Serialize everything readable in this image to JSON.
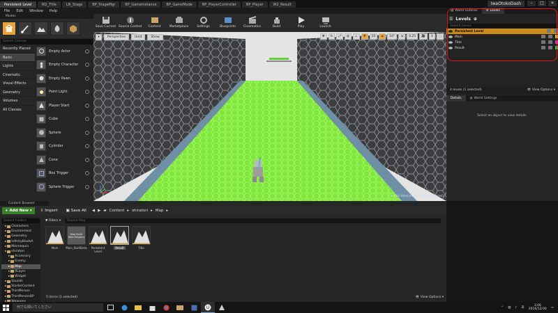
{
  "window": {
    "doc_tabs": [
      "Persistent Level",
      "W2_Title",
      "LN_Stage",
      "BP_StageMgr",
      "BP_GameInstance",
      "BP_GameMode",
      "BP_PlayerController",
      "BP_Player",
      "W2_Result"
    ],
    "project_name": "IwaOtokoDash",
    "win_buttons": [
      "–",
      "□",
      "✕"
    ]
  },
  "menu": [
    "File",
    "Edit",
    "Window",
    "Help"
  ],
  "modes": {
    "tab": "Modes",
    "search_placeholder": "Search Classes",
    "categories": [
      "Recently Placed",
      "Basic",
      "Lights",
      "Cinematic",
      "Visual Effects",
      "Geometry",
      "Volumes",
      "All Classes"
    ],
    "active_category": "Basic",
    "place_items": [
      "Empty Actor",
      "Empty Character",
      "Empty Pawn",
      "Point Light",
      "Player Start",
      "Cube",
      "Sphere",
      "Cylinder",
      "Cone",
      "Box Trigger",
      "Sphere Trigger"
    ]
  },
  "toolbar": {
    "buttons": [
      "Save Current",
      "Source Control",
      "Content",
      "Marketplace",
      "Settings",
      "Blueprints",
      "Cinematics",
      "Build",
      "Play",
      "Launch"
    ]
  },
  "viewport": {
    "perspective": "Perspective",
    "lit": "Unlit",
    "show": "Show",
    "snap_values": [
      "10",
      "10°",
      "0.25",
      "3"
    ],
    "level_label": "Level:  PersistentLevel (Persistent)"
  },
  "right_panel": {
    "tabs": [
      "World Outliner",
      "Levels"
    ],
    "levels_title": "Levels",
    "search_placeholder": "Search Levels",
    "levels": [
      {
        "name": "Persistent Level",
        "persistent": true,
        "color": ""
      },
      {
        "name": "Main",
        "persistent": false,
        "color": "#d8d830"
      },
      {
        "name": "Title",
        "persistent": false,
        "color": "#d83cc4"
      },
      {
        "name": "Result",
        "persistent": false,
        "color": "#3ccc3c"
      }
    ],
    "levels_footer": "4 levels (1 selected)",
    "view_options": "View Options",
    "details_tabs": [
      "Details",
      "World Settings"
    ],
    "details_message": "Select an object to view details."
  },
  "content_browser": {
    "tab": "Content Browser",
    "add_new": "Add New",
    "import": "Import",
    "save_all": "Save All",
    "path": [
      "Content",
      "shiratori",
      "Map"
    ],
    "tree_search": "Search Folders",
    "tree": [
      {
        "label": "Characters",
        "indent": 1,
        "selected": false
      },
      {
        "label": "Environment",
        "indent": 1,
        "selected": false
      },
      {
        "label": "Geometry",
        "indent": 1,
        "selected": false
      },
      {
        "label": "InfinityBladeA",
        "indent": 1,
        "selected": false
      },
      {
        "label": "Mannequin",
        "indent": 1,
        "selected": false
      },
      {
        "label": "shiratori",
        "indent": 1,
        "selected": false
      },
      {
        "label": "Accessory",
        "indent": 2,
        "selected": false
      },
      {
        "label": "Enemy",
        "indent": 2,
        "selected": false
      },
      {
        "label": "Map",
        "indent": 2,
        "selected": true
      },
      {
        "label": "PLayer",
        "indent": 2,
        "selected": false
      },
      {
        "label": "Widget",
        "indent": 2,
        "selected": false
      },
      {
        "label": "Sounds",
        "indent": 1,
        "selected": false
      },
      {
        "label": "StarterContent",
        "indent": 1,
        "selected": false
      },
      {
        "label": "ThirdPerson",
        "indent": 1,
        "selected": false
      },
      {
        "label": "ThirdPersonBP",
        "indent": 1,
        "selected": false
      },
      {
        "label": "Weapons",
        "indent": 1,
        "selected": false
      }
    ],
    "filters": "Filters",
    "asset_search": "Search Map",
    "assets": [
      {
        "name": "Main",
        "kind": "map",
        "selected": false
      },
      {
        "name": "Main_BuiltData",
        "kind": "data",
        "selected": false
      },
      {
        "name": "Persistent Level",
        "kind": "map",
        "selected": false
      },
      {
        "name": "Result",
        "kind": "map",
        "selected": true
      },
      {
        "name": "Title",
        "kind": "map",
        "selected": false
      }
    ],
    "builtdata_thumb_text": "Map Build Data Registry",
    "footer": "5 items (1 selected)",
    "view_options": "View Options"
  },
  "taskbar": {
    "search_placeholder": "何でも聞いてください",
    "time": "3:06",
    "date": "2016/12/30"
  },
  "colors": {
    "accent": "#e8a43b",
    "green_floor": "#7fe63a",
    "annotation": "#e0161b"
  }
}
